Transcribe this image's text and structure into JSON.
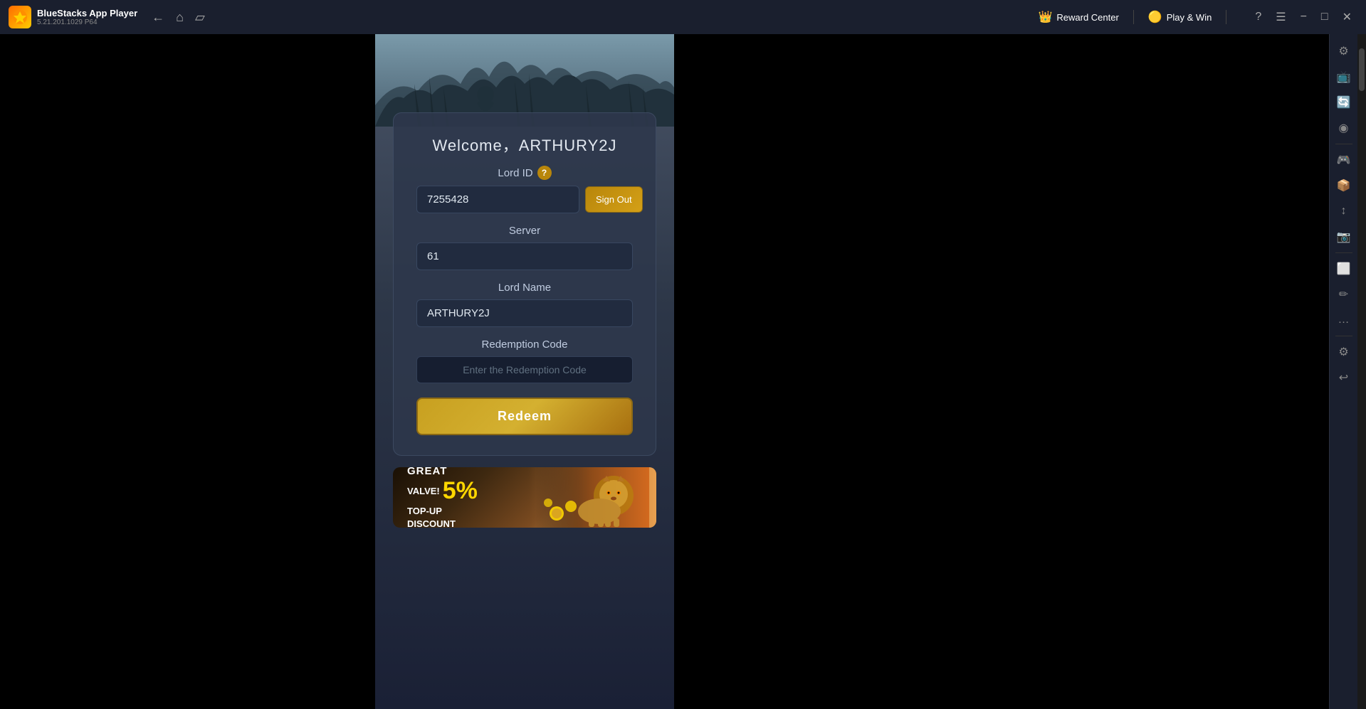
{
  "titlebar": {
    "app_title": "BlueStacks App Player",
    "app_version": "5.21.201.1029  P64",
    "reward_center_label": "Reward Center",
    "play_win_label": "Play & Win"
  },
  "form": {
    "welcome_title": "Welcome，ARTHURY2J",
    "lord_id_label": "Lord ID",
    "lord_id_value": "7255428",
    "sign_out_label": "Sign Out",
    "server_label": "Server",
    "server_value": "61",
    "lord_name_label": "Lord Name",
    "lord_name_value": "ARTHURY2J",
    "redemption_code_label": "Redemption Code",
    "redemption_code_placeholder": "Enter the Redemption Code",
    "redeem_label": "Redeem"
  },
  "banner": {
    "great_value": "GREAT",
    "valve_label": "VALVE!",
    "percent": "5%",
    "topup_label": "TOP-UP",
    "discount_label": "DISCOUNT"
  },
  "toolbar": {
    "items": [
      {
        "icon": "⚙",
        "name": "settings"
      },
      {
        "icon": "📺",
        "name": "display"
      },
      {
        "icon": "🔄",
        "name": "rotation"
      },
      {
        "icon": "◉",
        "name": "camera"
      },
      {
        "icon": "🎮",
        "name": "gamepad"
      },
      {
        "icon": "📦",
        "name": "apk"
      },
      {
        "icon": "↕",
        "name": "resize"
      },
      {
        "icon": "📌",
        "name": "pin"
      },
      {
        "icon": "⬜",
        "name": "window"
      },
      {
        "icon": "✏",
        "name": "edit"
      },
      {
        "icon": "…",
        "name": "more"
      },
      {
        "icon": "⚙",
        "name": "config"
      },
      {
        "icon": "↩",
        "name": "back2"
      }
    ]
  }
}
